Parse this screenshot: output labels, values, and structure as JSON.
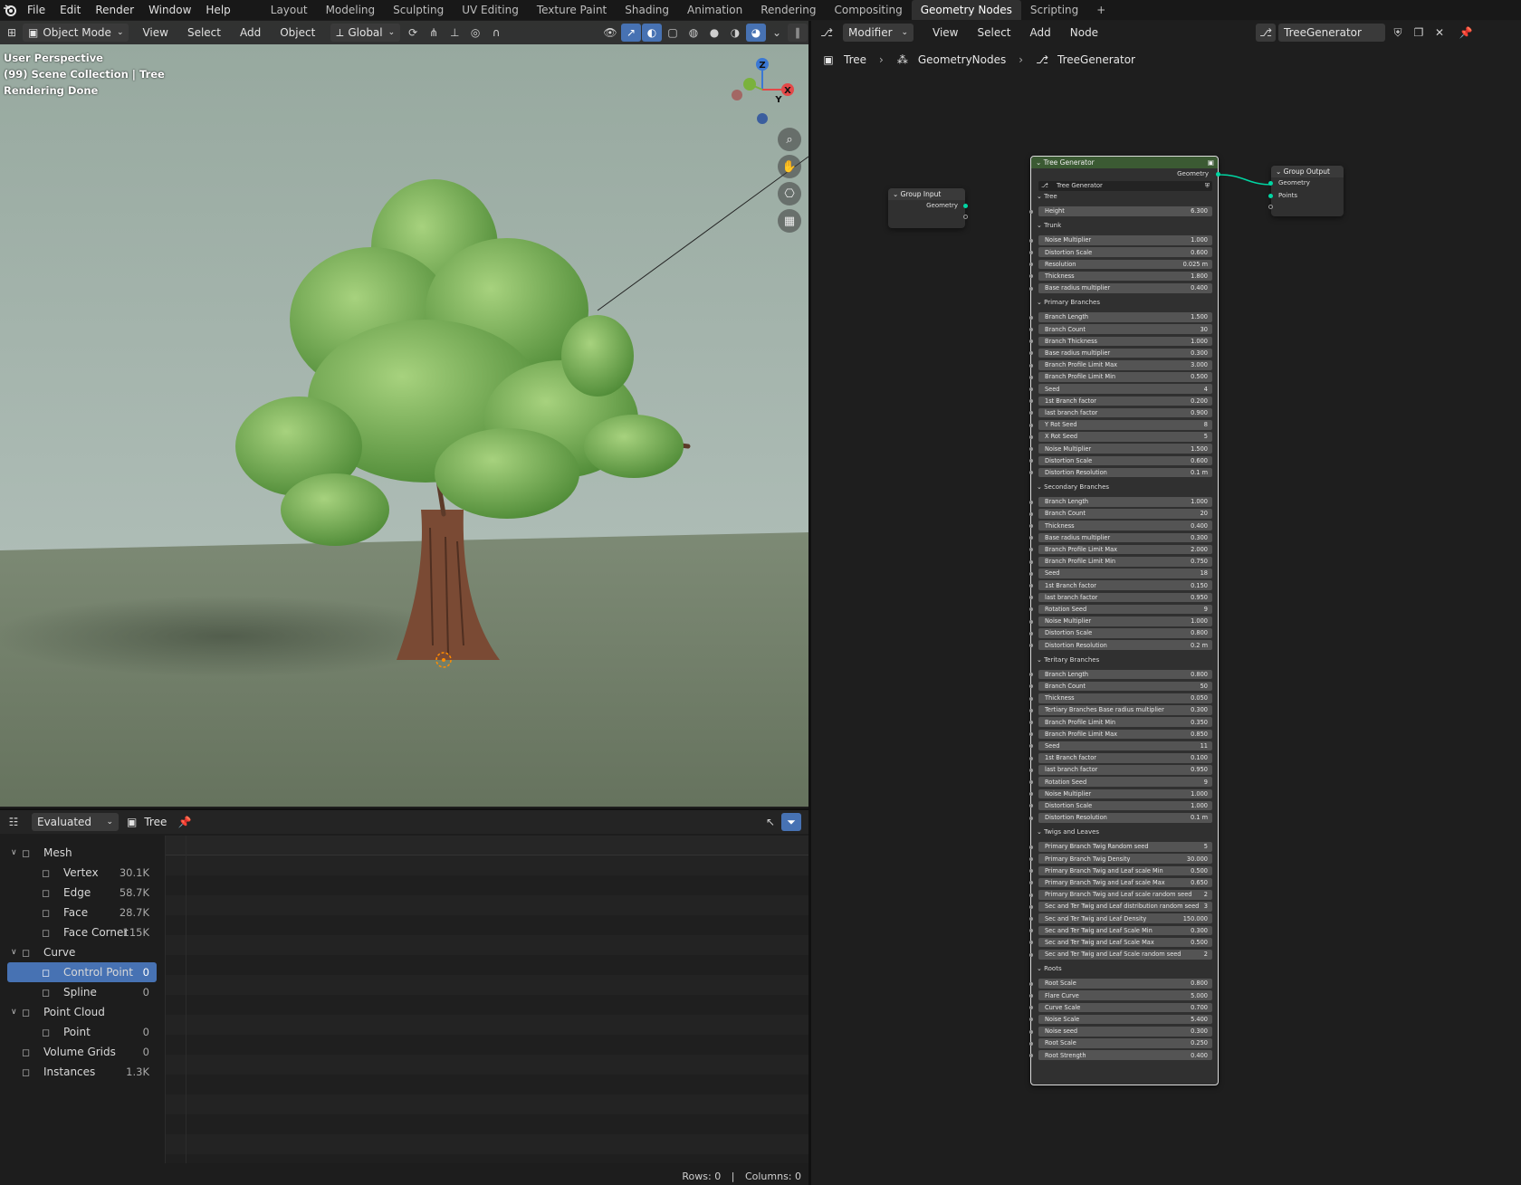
{
  "topbar": {
    "menus": [
      "File",
      "Edit",
      "Render",
      "Window",
      "Help"
    ],
    "workspaces": [
      "Layout",
      "Modeling",
      "Sculpting",
      "UV Editing",
      "Texture Paint",
      "Shading",
      "Animation",
      "Rendering",
      "Compositing",
      "Geometry Nodes",
      "Scripting"
    ],
    "active_workspace": "Geometry Nodes",
    "add_tab": "+"
  },
  "viewport": {
    "mode": "Object Mode",
    "menus": [
      "View",
      "Select",
      "Add",
      "Object"
    ],
    "orientation": "Global",
    "info_line1": "User Perspective",
    "info_line2": "(99) Scene Collection | Tree",
    "info_line3": "Rendering Done",
    "gizmo": {
      "z": "Z",
      "y": "Y",
      "x": "X"
    }
  },
  "spreadsheet": {
    "evaluation": "Evaluated",
    "object": "Tree",
    "tree": [
      {
        "label": "Mesh",
        "count": "",
        "level": 0,
        "expanded": true,
        "icon": "mesh-icon"
      },
      {
        "label": "Vertex",
        "count": "30.1K",
        "level": 1,
        "icon": "vertex-icon"
      },
      {
        "label": "Edge",
        "count": "58.7K",
        "level": 1,
        "icon": "edge-icon"
      },
      {
        "label": "Face",
        "count": "28.7K",
        "level": 1,
        "icon": "face-icon"
      },
      {
        "label": "Face Corner",
        "count": "115K",
        "level": 1,
        "icon": "face-corner-icon"
      },
      {
        "label": "Curve",
        "count": "",
        "level": 0,
        "expanded": true,
        "icon": "curve-icon"
      },
      {
        "label": "Control Point",
        "count": "0",
        "level": 1,
        "selected": true,
        "icon": "control-point-icon"
      },
      {
        "label": "Spline",
        "count": "0",
        "level": 1,
        "icon": "spline-icon"
      },
      {
        "label": "Point Cloud",
        "count": "",
        "level": 0,
        "expanded": true,
        "icon": "point-cloud-icon"
      },
      {
        "label": "Point",
        "count": "0",
        "level": 1,
        "icon": "point-icon"
      },
      {
        "label": "Volume Grids",
        "count": "0",
        "level": 0,
        "icon": "volume-icon"
      },
      {
        "label": "Instances",
        "count": "1.3K",
        "level": 0,
        "icon": "instances-icon"
      }
    ],
    "rows_label": "Rows: 0",
    "columns_label": "Columns: 0",
    "status_sep": "|"
  },
  "node_editor": {
    "editor_type": "Modifier",
    "menus": [
      "View",
      "Select",
      "Add",
      "Node"
    ],
    "node_group": "TreeGenerator",
    "breadcrumb": [
      "Tree",
      "GeometryNodes",
      "TreeGenerator"
    ],
    "group_input": {
      "title": "Group Input",
      "output": "Geometry"
    },
    "group_output": {
      "title": "Group Output",
      "inputs": [
        "Geometry",
        "Points"
      ]
    },
    "tree_generator": {
      "title": "Tree Generator",
      "output": "Geometry",
      "subgroup": "Tree Generator",
      "sections": [
        {
          "name": "Tree",
          "fields": [
            [
              "Height",
              "6.300"
            ]
          ]
        },
        {
          "name": "Trunk",
          "fields": [
            [
              "Noise Multiplier",
              "1.000"
            ],
            [
              "Distortion Scale",
              "0.600"
            ],
            [
              "Resolution",
              "0.025 m"
            ],
            [
              "Thickness",
              "1.800"
            ],
            [
              "Base radius multiplier",
              "0.400"
            ]
          ]
        },
        {
          "name": "Primary Branches",
          "fields": [
            [
              "Branch Length",
              "1.500"
            ],
            [
              "Branch Count",
              "30"
            ],
            [
              "Branch Thickness",
              "1.000"
            ],
            [
              "Base radius multiplier",
              "0.300"
            ],
            [
              "Branch Profile Limit Max",
              "3.000"
            ],
            [
              "Branch Profile Limit Min",
              "0.500"
            ],
            [
              "Seed",
              "4"
            ],
            [
              "1st Branch factor",
              "0.200"
            ],
            [
              "last branch factor",
              "0.900"
            ],
            [
              "Y Rot Seed",
              "8"
            ],
            [
              "X Rot Seed",
              "5"
            ],
            [
              "Noise Multiplier",
              "1.500"
            ],
            [
              "Distortion Scale",
              "0.600"
            ],
            [
              "Distortion Resolution",
              "0.1 m"
            ]
          ]
        },
        {
          "name": "Secondary Branches",
          "fields": [
            [
              "Branch Length",
              "1.000"
            ],
            [
              "Branch Count",
              "20"
            ],
            [
              "Thickness",
              "0.400"
            ],
            [
              "Base radius multiplier",
              "0.300"
            ],
            [
              "Branch Profile Limit Max",
              "2.000"
            ],
            [
              "Branch Profile Limit Min",
              "0.750"
            ],
            [
              "Seed",
              "18"
            ],
            [
              "1st Branch factor",
              "0.150"
            ],
            [
              "last branch factor",
              "0.950"
            ],
            [
              "Rotation Seed",
              "9"
            ],
            [
              "Noise Multiplier",
              "1.000"
            ],
            [
              "Distortion Scale",
              "0.800"
            ],
            [
              "Distortion Resolution",
              "0.2 m"
            ]
          ]
        },
        {
          "name": "Teritary Branches",
          "fields": [
            [
              "Branch Length",
              "0.800"
            ],
            [
              "Branch Count",
              "50"
            ],
            [
              "Thickness",
              "0.050"
            ],
            [
              "Tertiary Branches Base radius multiplier",
              "0.300"
            ],
            [
              "Branch Profile Limit Min",
              "0.350"
            ],
            [
              "Branch Profile Limit Max",
              "0.850"
            ],
            [
              "Seed",
              "11"
            ],
            [
              "1st Branch factor",
              "0.100"
            ],
            [
              "last branch factor",
              "0.950"
            ],
            [
              "Rotation Seed",
              "9"
            ],
            [
              "Noise Multiplier",
              "1.000"
            ],
            [
              "Distortion Scale",
              "1.000"
            ],
            [
              "Distortion Resolution",
              "0.1 m"
            ]
          ]
        },
        {
          "name": "Twigs and Leaves",
          "fields": [
            [
              "Primary Branch Twig Random seed",
              "5"
            ],
            [
              "Primary Branch Twig Density",
              "30.000"
            ],
            [
              "Primary Branch Twig and Leaf scale Min",
              "0.500"
            ],
            [
              "Primary Branch Twig and Leaf scale Max",
              "0.650"
            ],
            [
              "Primary Branch Twig and Leaf scale random seed",
              "2"
            ],
            [
              "Sec and Ter Twig and Leaf distribution random seed",
              "3"
            ],
            [
              "Sec and Ter Twig and Leaf Density",
              "150.000"
            ],
            [
              "Sec and Ter Twig and Leaf Scale Min",
              "0.300"
            ],
            [
              "Sec and Ter Twig and Leaf Scale Max",
              "0.500"
            ],
            [
              "Sec and Ter Twig and Leaf Scale random seed",
              "2"
            ]
          ]
        },
        {
          "name": "Roots",
          "fields": [
            [
              "Root Scale",
              "0.800"
            ],
            [
              "Flare Curve",
              "5.000"
            ],
            [
              "Curve Scale",
              "0.700"
            ],
            [
              "Noise Scale",
              "5.400"
            ],
            [
              "Noise seed",
              "0.300"
            ],
            [
              "Root Scale",
              "0.250"
            ],
            [
              "Root Strength",
              "0.400"
            ]
          ]
        }
      ]
    }
  },
  "colors": {
    "accent": "#4772b3",
    "node_header": "#3b5a33",
    "geometry_socket": "#00d6a3"
  }
}
